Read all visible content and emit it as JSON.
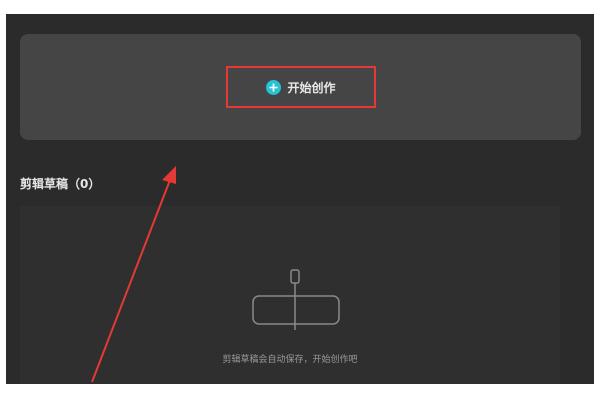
{
  "create_panel": {
    "button_label": "开始创作",
    "icon": "plus-circle-icon",
    "accent_color": "#27c2d4",
    "highlight_color": "#e53935"
  },
  "drafts": {
    "title": "剪辑草稿（0）",
    "empty_icon": "timeline-clip-icon",
    "empty_message": "剪辑草稿会自动保存，开始创作吧"
  },
  "annotation": {
    "arrow_icon": "red-arrow-annotation",
    "arrow_color": "#e53935"
  }
}
